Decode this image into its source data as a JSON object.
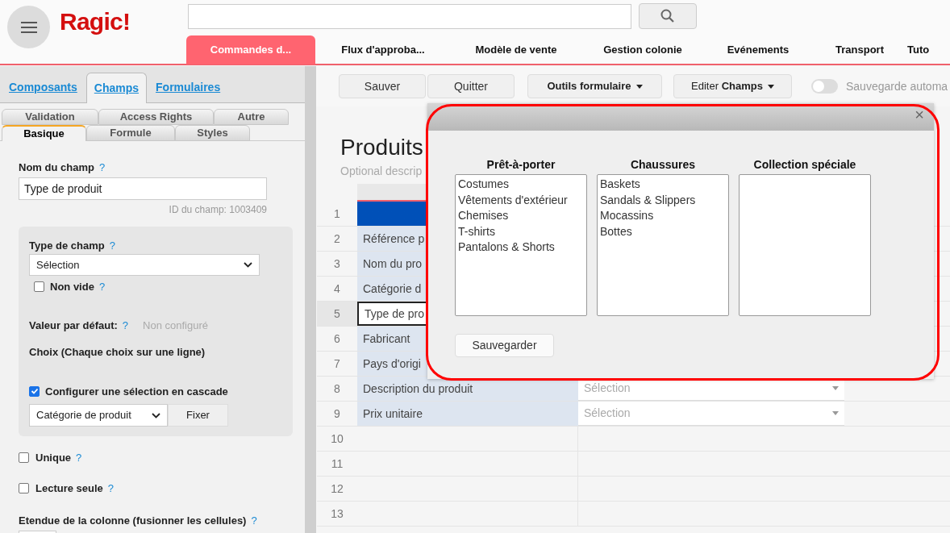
{
  "header": {
    "logo": "Ragic!"
  },
  "nav_tabs": [
    {
      "label": "Commandes d...",
      "selected": true
    },
    {
      "label": "Flux d'approba...",
      "selected": false
    },
    {
      "label": "Modèle de vente",
      "selected": false
    },
    {
      "label": "Gestion colonie",
      "selected": false
    },
    {
      "label": "Evénements",
      "selected": false
    },
    {
      "label": "Transport",
      "selected": false
    },
    {
      "label": "Tuto",
      "selected": false
    }
  ],
  "sidebar": {
    "tabs": [
      {
        "label": "Composants",
        "selected": false
      },
      {
        "label": "Champs",
        "selected": true
      },
      {
        "label": "Formulaires",
        "selected": false
      }
    ],
    "subtabs_back": [
      {
        "label": "Validation",
        "selected": false
      },
      {
        "label": "Access Rights",
        "selected": false
      },
      {
        "label": "Autre",
        "selected": false
      }
    ],
    "subtabs_front": [
      {
        "label": "Basique",
        "selected": true
      },
      {
        "label": "Formule",
        "selected": false
      },
      {
        "label": "Styles",
        "selected": false
      }
    ],
    "field_name": {
      "label": "Nom du champ",
      "help": "?",
      "value": "Type de produit",
      "id_text": "ID du champ: 1003409"
    },
    "field_type": {
      "label": "Type de champ",
      "help": "?",
      "value": "Sélection"
    },
    "non_empty": {
      "label": "Non vide",
      "help": "?",
      "checked": false
    },
    "default_value": {
      "label": "Valeur par défaut:",
      "help": "?",
      "value": "Non configuré"
    },
    "choices_label": "Choix (Chaque choix sur une ligne)",
    "cascade": {
      "label": "Configurer une sélection en cascade",
      "checked": true,
      "select": "Catégorie de produit",
      "button": "Fixer"
    },
    "unique": {
      "label": "Unique",
      "help": "?",
      "checked": false
    },
    "read_only": {
      "label": "Lecture seule",
      "help": "?",
      "checked": false
    },
    "column_span": {
      "label": "Etendue de la colonne (fusionner les cellules)",
      "help": "?"
    }
  },
  "toolbar": {
    "buttons": [
      "Sauver",
      "Quitter"
    ],
    "form_tools": "Outils formulaire",
    "edit_prefix": "Editer",
    "edit_bold": "Champs",
    "autosave": {
      "label": "Sauvegarde automa",
      "on": false
    }
  },
  "form": {
    "title": "Produits",
    "description": "Optional descrip"
  },
  "grid": {
    "rows": [
      {
        "number": "1",
        "kind": "header"
      },
      {
        "number": "2",
        "label": "Référence p"
      },
      {
        "number": "3",
        "label": "Nom du pro"
      },
      {
        "number": "4",
        "label": "Catégorie d"
      },
      {
        "number": "5",
        "label": "Type de pro",
        "selected": true
      },
      {
        "number": "6",
        "label": "Fabricant"
      },
      {
        "number": "7",
        "label": "Pays d'origi"
      },
      {
        "number": "8",
        "label": "Description du produit",
        "placeholder": "Sélection"
      },
      {
        "number": "9",
        "label": "Prix unitaire",
        "placeholder": "Sélection"
      },
      {
        "number": "10",
        "kind": "empty"
      },
      {
        "number": "11",
        "kind": "empty"
      },
      {
        "number": "12",
        "kind": "empty"
      },
      {
        "number": "13",
        "kind": "empty"
      }
    ]
  },
  "dialog": {
    "close": "×",
    "columns": [
      {
        "title": "Prêt-à-porter",
        "lines": [
          "Costumes",
          "Vêtements d'extérieur",
          "Chemises",
          "T-shirts",
          "Pantalons & Shorts"
        ]
      },
      {
        "title": "Chaussures",
        "lines": [
          "Baskets",
          "Sandals & Slippers",
          "Mocassins",
          "Bottes"
        ]
      },
      {
        "title": "Collection spéciale"
      }
    ],
    "save": "Sauvegarder"
  }
}
